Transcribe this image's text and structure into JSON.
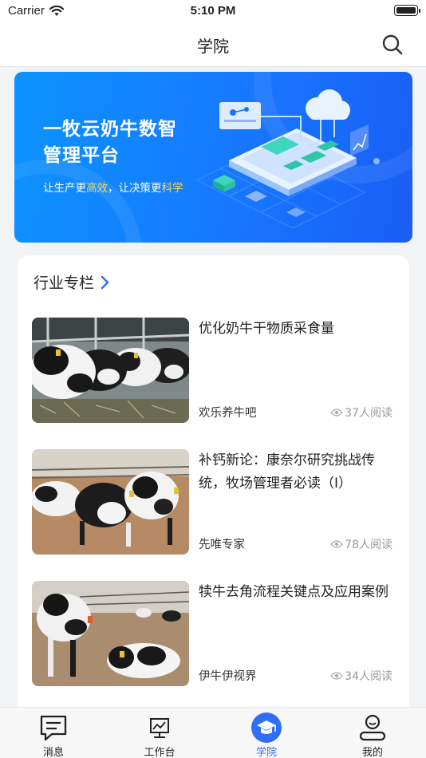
{
  "status_bar": {
    "carrier": "Carrier",
    "time": "5:10 PM"
  },
  "header": {
    "title": "学院"
  },
  "banner": {
    "title_line1": "一牧云奶牛数智",
    "title_line2": "管理平台",
    "slogan_part1": "让生产更",
    "slogan_hl1": "高效",
    "slogan_part2": "，让决策更",
    "slogan_hl2": "科学"
  },
  "section": {
    "title": "行业专栏",
    "articles": [
      {
        "title": "优化奶牛干物质采食量",
        "source": "欢乐养牛吧",
        "reads": "37人阅读"
      },
      {
        "title": "补钙新论：康奈尔研究挑战传统，牧场管理者必读（I）",
        "source": "先唯专家",
        "reads": "78人阅读"
      },
      {
        "title": "犊牛去角流程关键点及应用案例",
        "source": "伊牛伊视界",
        "reads": "34人阅读"
      }
    ]
  },
  "tabbar": {
    "items": [
      {
        "label": "消息",
        "icon": "message-icon"
      },
      {
        "label": "工作台",
        "icon": "workbench-icon"
      },
      {
        "label": "学院",
        "icon": "academy-icon"
      },
      {
        "label": "我的",
        "icon": "profile-icon"
      }
    ],
    "active_color": "#2f6ef5"
  }
}
